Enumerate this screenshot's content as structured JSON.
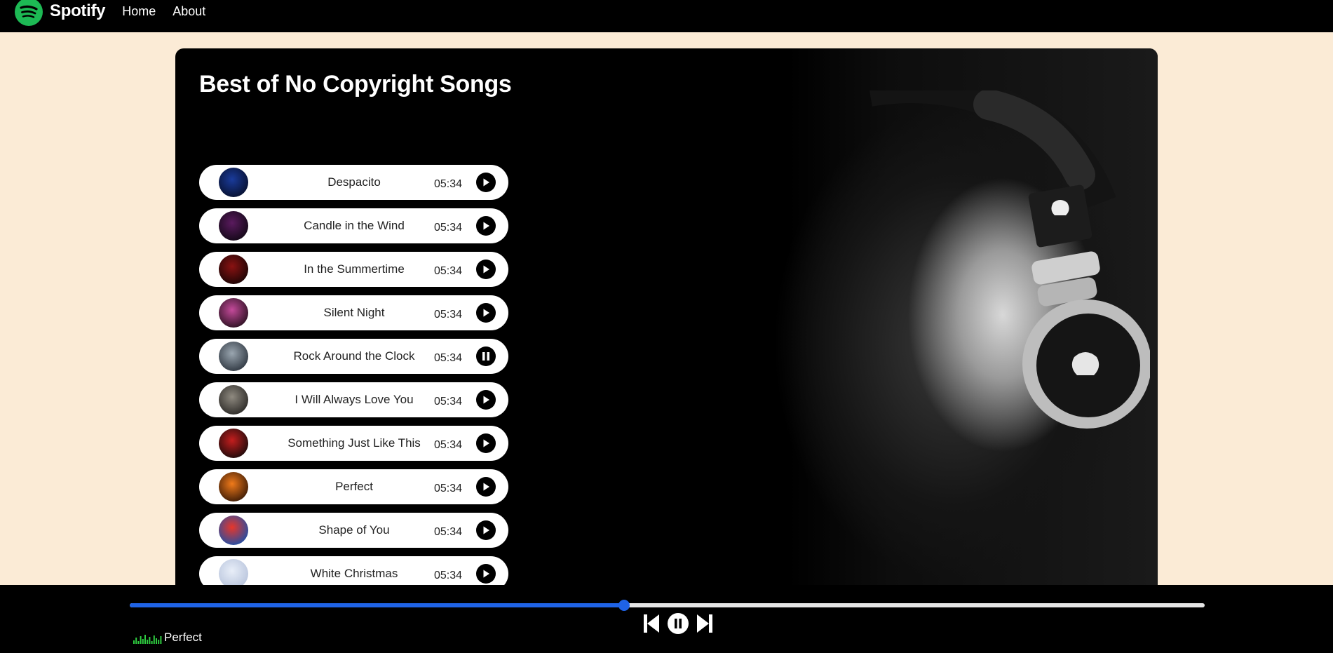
{
  "app": {
    "name": "Spotify",
    "brand_color": "#1db954"
  },
  "nav": {
    "links": [
      {
        "label": "Home"
      },
      {
        "label": "About"
      }
    ]
  },
  "main": {
    "title": "Best of No Copyright Songs",
    "songs": [
      {
        "name": "Despacito",
        "duration": "05:34",
        "state": "play",
        "cover": [
          "#1a3b9b",
          "#07102e"
        ]
      },
      {
        "name": "Candle in the Wind",
        "duration": "05:34",
        "state": "play",
        "cover": [
          "#5a1a5e",
          "#120816"
        ]
      },
      {
        "name": "In the Summertime",
        "duration": "05:34",
        "state": "play",
        "cover": [
          "#8a1212",
          "#1a0505"
        ]
      },
      {
        "name": "Silent Night",
        "duration": "05:34",
        "state": "play",
        "cover": [
          "#c44a9a",
          "#2a1020"
        ]
      },
      {
        "name": "Rock Around the Clock",
        "duration": "05:34",
        "state": "pause",
        "cover": [
          "#9aa6b0",
          "#2e3640"
        ]
      },
      {
        "name": "I Will Always Love You",
        "duration": "05:34",
        "state": "play",
        "cover": [
          "#8f8a80",
          "#2b2926"
        ]
      },
      {
        "name": "Something Just Like This",
        "duration": "05:34",
        "state": "play",
        "cover": [
          "#c41e1e",
          "#1a0a0a"
        ]
      },
      {
        "name": "Perfect",
        "duration": "05:34",
        "state": "play",
        "cover": [
          "#f07a1a",
          "#3a1a06"
        ]
      },
      {
        "name": "Shape of You",
        "duration": "05:34",
        "state": "play",
        "cover": [
          "#e8362a",
          "#1c4fa8"
        ]
      },
      {
        "name": "White Christmas",
        "duration": "05:34",
        "state": "play",
        "cover": [
          "#e8eef8",
          "#b8c4dc"
        ]
      }
    ]
  },
  "player": {
    "progress_fraction": 0.46,
    "accent_color": "#1f63e6",
    "now_playing": "Perfect",
    "eq_color": "#2ecc40"
  }
}
